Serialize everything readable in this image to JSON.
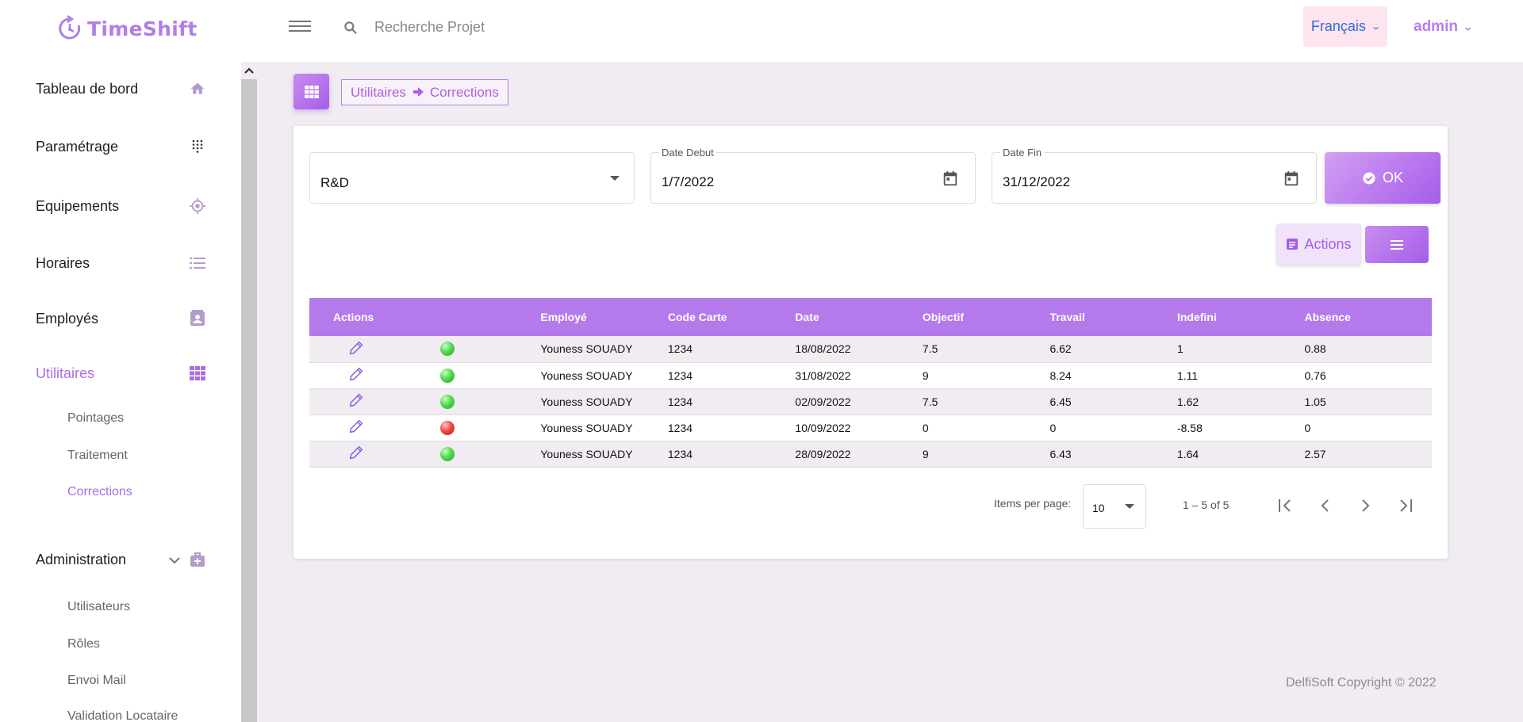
{
  "app": {
    "name": "TimeShift"
  },
  "sidebar": {
    "items": [
      {
        "label": "Tableau de bord",
        "icon": "home-icon"
      },
      {
        "label": "Paramétrage",
        "icon": "dots-grid-icon"
      },
      {
        "label": "Equipements",
        "icon": "target-icon"
      },
      {
        "label": "Horaires",
        "icon": "list-icon"
      },
      {
        "label": "Employés",
        "icon": "contact-card-icon"
      },
      {
        "label": "Utilitaires",
        "icon": "table-icon",
        "active": true
      }
    ],
    "utilitaires_sub": [
      "Pointages",
      "Traitement",
      "Corrections"
    ],
    "administration": {
      "label": "Administration",
      "icon": "medical-bag-icon"
    },
    "administration_sub": [
      "Utilisateurs",
      "Rôles",
      "Envoi Mail",
      "Validation Locataire"
    ]
  },
  "topbar": {
    "search_placeholder": "Recherche Projet",
    "language": "Français",
    "user": "admin"
  },
  "breadcrumb": {
    "parent": "Utilitaires",
    "current": "Corrections"
  },
  "filters": {
    "department": "R&D",
    "date_debut_label": "Date Debut",
    "date_debut": "1/7/2022",
    "date_fin_label": "Date Fin",
    "date_fin": "31/12/2022",
    "ok_label": "OK",
    "actions_label": "Actions"
  },
  "table": {
    "columns": [
      "Actions",
      "",
      "Employé",
      "Code Carte",
      "Date",
      "Objectif",
      "Travail",
      "Indefini",
      "Absence"
    ],
    "rows": [
      {
        "status": "green",
        "employe": "Youness SOUADY",
        "code_carte": "1234",
        "date": "18/08/2022",
        "objectif": "7.5",
        "travail": "6.62",
        "indefini": "1",
        "absence": "0.88"
      },
      {
        "status": "green",
        "employe": "Youness SOUADY",
        "code_carte": "1234",
        "date": "31/08/2022",
        "objectif": "9",
        "travail": "8.24",
        "indefini": "1.11",
        "absence": "0.76"
      },
      {
        "status": "green",
        "employe": "Youness SOUADY",
        "code_carte": "1234",
        "date": "02/09/2022",
        "objectif": "7.5",
        "travail": "6.45",
        "indefini": "1.62",
        "absence": "1.05"
      },
      {
        "status": "red",
        "employe": "Youness SOUADY",
        "code_carte": "1234",
        "date": "10/09/2022",
        "objectif": "0",
        "travail": "0",
        "indefini": "-8.58",
        "absence": "0"
      },
      {
        "status": "green",
        "employe": "Youness SOUADY",
        "code_carte": "1234",
        "date": "28/09/2022",
        "objectif": "9",
        "travail": "6.43",
        "indefini": "1.64",
        "absence": "2.57"
      }
    ]
  },
  "paginator": {
    "items_per_page_label": "Items per page:",
    "items_per_page": "10",
    "range": "1 – 5 of 5"
  },
  "footer": "DelfiSoft Copyright © 2022",
  "colors": {
    "accent": "#b47aeb",
    "accent_dark": "#a55de9",
    "status_ok": "#2ba52a",
    "status_error": "#b81d1d"
  }
}
